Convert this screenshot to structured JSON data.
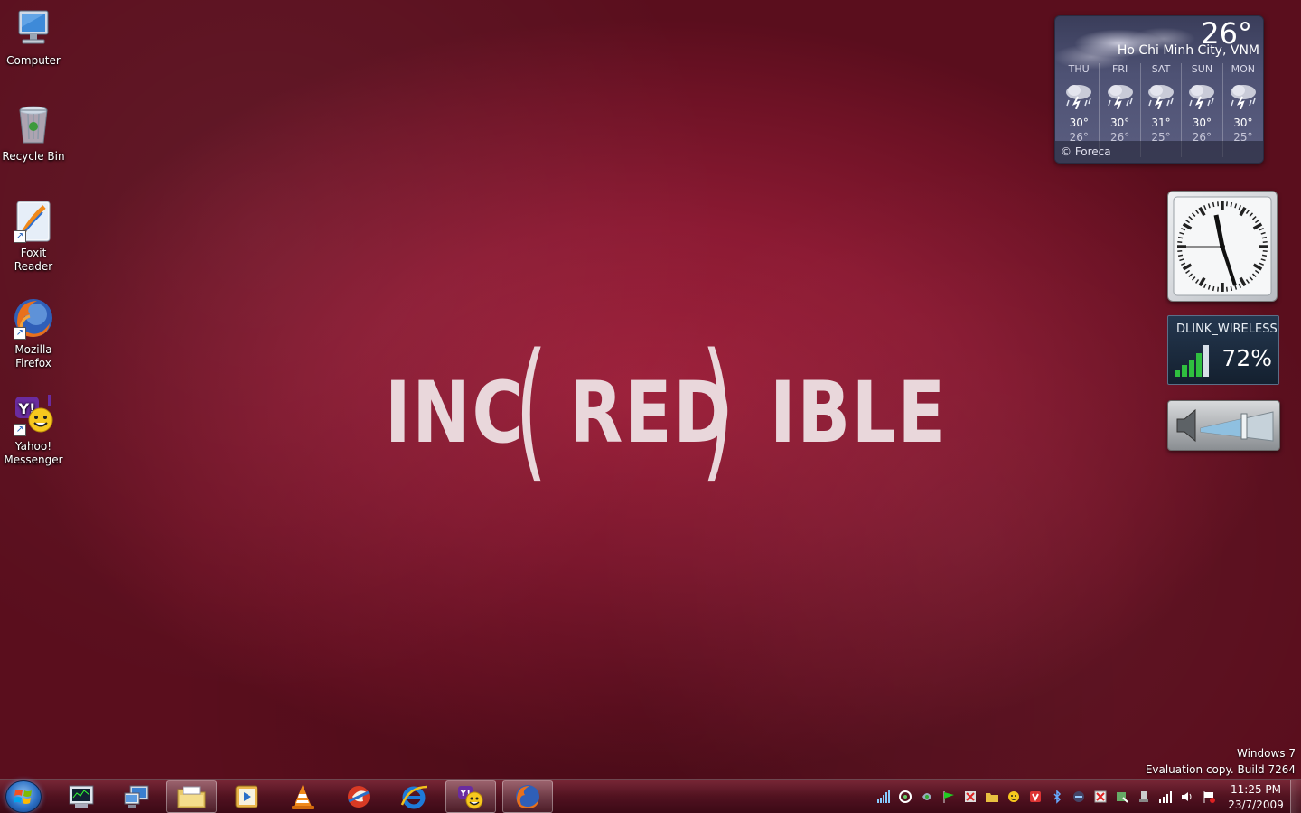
{
  "wallpaper": {
    "logo": {
      "left": "INC",
      "open": "(",
      "middle": "RED",
      "close": ")",
      "right": "IBLE"
    }
  },
  "desktop_icons": [
    {
      "label_1": "Computer",
      "label_2": "",
      "icon": "computer-icon"
    },
    {
      "label_1": "Recycle Bin",
      "label_2": "",
      "icon": "recycle-bin-icon"
    },
    {
      "label_1": "Foxit Reader",
      "label_2": "",
      "icon": "foxit-reader-icon"
    },
    {
      "label_1": "Mozilla",
      "label_2": "Firefox",
      "icon": "firefox-icon"
    },
    {
      "label_1": "Yahoo!",
      "label_2": "Messenger",
      "icon": "yahoo-messenger-icon"
    }
  ],
  "weather": {
    "temp": "26°",
    "city": "Ho Chi Minh City, VNM",
    "days": [
      {
        "name": "THU",
        "hi": "30°",
        "lo": "26°"
      },
      {
        "name": "FRI",
        "hi": "30°",
        "lo": "26°"
      },
      {
        "name": "SAT",
        "hi": "31°",
        "lo": "25°"
      },
      {
        "name": "SUN",
        "hi": "30°",
        "lo": "26°"
      },
      {
        "name": "MON",
        "hi": "30°",
        "lo": "25°"
      }
    ],
    "credit": "© Foreca"
  },
  "wifi": {
    "ssid": "DLINK_WIRELESS",
    "signal": "72%",
    "signal_fraction": 0.72
  },
  "volume": {
    "level_fraction": 0.6
  },
  "watermark": {
    "line1": "Windows 7",
    "line2": "Evaluation copy. Build 7264"
  },
  "taskbar": {
    "pinned": [
      {
        "icon": "task-manager-icon",
        "running": false
      },
      {
        "icon": "remote-desktop-icon",
        "running": false
      },
      {
        "icon": "windows-explorer-icon",
        "running": true
      },
      {
        "icon": "media-player-icon",
        "running": false
      },
      {
        "icon": "vlc-icon",
        "running": false
      },
      {
        "icon": "red-app-icon",
        "running": false
      },
      {
        "icon": "internet-explorer-icon",
        "running": false
      },
      {
        "icon": "yahoo-messenger-icon",
        "running": true
      },
      {
        "icon": "firefox-icon",
        "running": true
      }
    ],
    "clock_time": "11:25 PM",
    "clock_date": "23/7/2009"
  },
  "colors": {
    "wallpaper_red": "#8c1a33",
    "logo_text": "#e9d7db",
    "start_orb": "#2b6fc4"
  }
}
